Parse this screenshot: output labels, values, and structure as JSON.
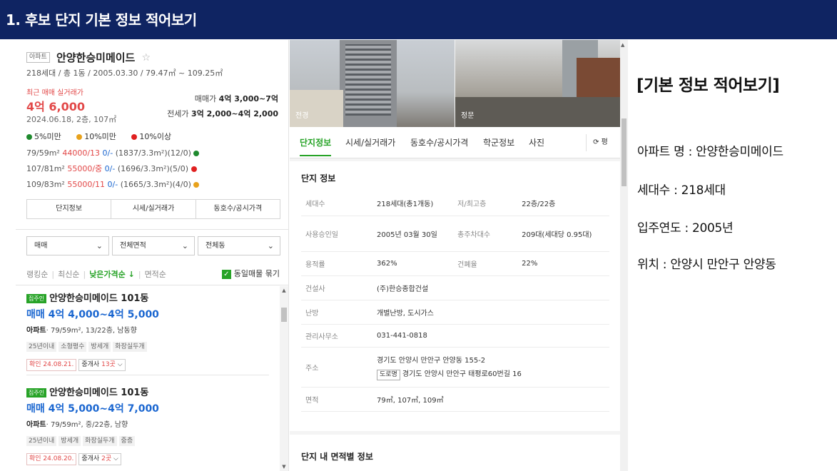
{
  "banner": {
    "title": "1. 후보 단지 기본 정보 적어보기"
  },
  "left": {
    "type_badge": "아파트",
    "apt_name": "안양한승미메이드",
    "star": "☆",
    "meta": "218세대 / 총 1동 / 2005.03.30 / 79.47㎡ ~ 109.25㎡",
    "recent_label": "최근 매매 실거래가",
    "recent_price": "4억 6,000",
    "recent_date": "2024.06.18, 2층, 107㎡",
    "sale_label": "매매가",
    "sale_value": "4억 3,000~7억",
    "jeonse_label": "전세가",
    "jeonse_value": "3억 2,000~4억 2,000",
    "legend": [
      "5%미만",
      "10%미만",
      "10%이상"
    ],
    "legend_colors": [
      "#1f8a2e",
      "#e8a21c",
      "#e02020"
    ],
    "areas": [
      {
        "size": "79/59m²",
        "price": "44000/13",
        "ratio": "0/-",
        "rest": "(1837/3.3m²)(12/0)",
        "dot": "#1f8a2e"
      },
      {
        "size": "107/81m²",
        "price": "55000/중",
        "ratio": "0/-",
        "rest": "(1696/3.3m²)(5/0)",
        "dot": "#e02020"
      },
      {
        "size": "109/83m²",
        "price": "55000/11",
        "ratio": "0/-",
        "rest": "(1665/3.3m²)(4/0)",
        "dot": "#e8a21c"
      }
    ],
    "tabs": [
      "단지정보",
      "시세/실거래가",
      "동호수/공시가격"
    ],
    "filters": [
      "매매",
      "전체면적",
      "전체동"
    ],
    "sort": [
      "랭킹순",
      "최신순",
      "낮은가격순 ↓",
      "면적순"
    ],
    "bundle_label": "동일매물 묶기",
    "listings": [
      {
        "badge": "집주인",
        "title": "안양한승미메이드 101동",
        "price": "매매 4억 4,000~4억 5,000",
        "type": "아파트",
        "desc": "· 79/59m², 13/22층, 남동향",
        "tags": [
          "25년이내",
          "소형평수",
          "방세개",
          "화장실두개"
        ],
        "confirm": "확인 24.08.21.",
        "broker_prefix": "중개사",
        "broker_count": "13곳"
      },
      {
        "badge": "집주인",
        "title": "안양한승미메이드 101동",
        "price": "매매 4억 5,000~4억 7,000",
        "type": "아파트",
        "desc": "· 79/59m², 중/22층, 남향",
        "tags": [
          "25년이내",
          "방세개",
          "화장실두개",
          "중층"
        ],
        "confirm": "확인 24.08.20.",
        "broker_prefix": "중개사",
        "broker_count": "2곳"
      }
    ]
  },
  "mid": {
    "photo_labels": [
      "전경",
      "정문"
    ],
    "tabs": [
      "단지정보",
      "시세/실거래가",
      "동호수/공시가격",
      "학군정보",
      "사진"
    ],
    "refresh_label": "⟳ 평",
    "info_title": "단지 정보",
    "info": {
      "households_k": "세대수",
      "households_v": "218세대(총1개동)",
      "floors_k": "저/최고층",
      "floors_v": "22층/22층",
      "approved_k": "사용승인일",
      "approved_v": "2005년 03월 30일",
      "parking_k": "총주차대수",
      "parking_v": "209대(세대당 0.95대)",
      "far_k": "용적률",
      "far_v": "362%",
      "bcr_k": "건폐율",
      "bcr_v": "22%",
      "builder_k": "건설사",
      "builder_v": "(주)한승종합건설",
      "heating_k": "난방",
      "heating_v": "개별난방, 도시가스",
      "office_k": "관리사무소",
      "office_v": "031-441-0818",
      "address_k": "주소",
      "address_v": "경기도 안양시 만안구 안양동 155-2",
      "road_badge": "도로명",
      "road_v": "경기도 안양시 만안구 태평로60번길 16",
      "area_k": "면적",
      "area_v": "79㎡, 107㎡, 109㎡"
    },
    "area_section_title": "단지 내 면적별 정보"
  },
  "notes": {
    "title": "[기본 정보 적어보기]",
    "name": "아파트 명 : 안양한승미메이드",
    "households": "세대수 : 218세대",
    "year": "입주연도 : 2005년",
    "location": "위치 : 안양시 만안구 안양동"
  }
}
